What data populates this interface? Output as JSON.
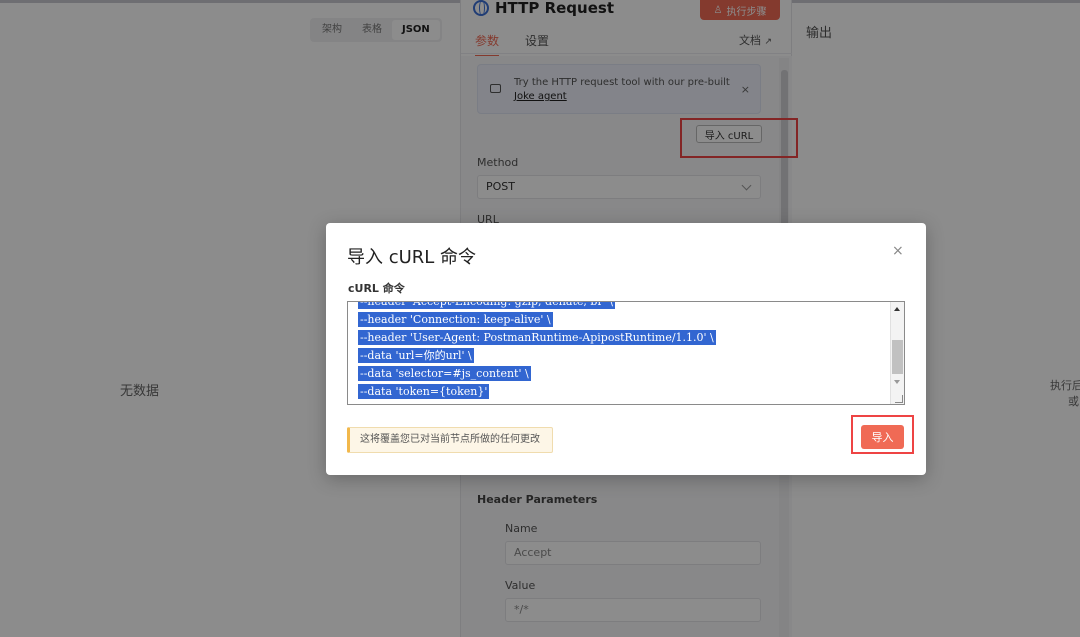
{
  "background": {
    "view_tabs": [
      "架构",
      "表格",
      "JSON"
    ],
    "active_view_tab": "JSON",
    "left_empty_text": "无数据",
    "output_title": "输出",
    "right_hint_line1": "执行后",
    "right_hint_line2": "或"
  },
  "panel": {
    "title": "HTTP Request",
    "run_button_label": "执行步骤",
    "tabs": [
      {
        "label": "参数",
        "active": true
      },
      {
        "label": "设置",
        "active": false
      }
    ],
    "doc_link": "文档",
    "banner": {
      "text": "Try the HTTP request tool with our pre-built",
      "link": "Joke agent",
      "close": "×"
    },
    "import_curl_label": "导入 cURL",
    "method_label": "Method",
    "method_value": "POST",
    "url_label": "URL",
    "header_section_label": "Header Parameters",
    "name_label": "Name",
    "name_value": "Accept",
    "value_label": "Value",
    "value_value": "*/*"
  },
  "modal": {
    "title": "导入 cURL 命令",
    "close": "×",
    "field_label": "cURL 命令",
    "code_lines": [
      "--header 'Accept-Encoding: gzip, deflate, br' \\",
      "--header 'Connection: keep-alive' \\",
      "--header 'User-Agent: PostmanRuntime-ApipostRuntime/1.1.0' \\",
      "--data 'url=你的url' \\",
      "--data 'selector=#js_content' \\",
      "--data 'token={token}'"
    ],
    "warning_text": "这将覆盖您已对当前节点所做的任何更改",
    "import_button_label": "导入"
  },
  "colors": {
    "accent": "#f06a55",
    "selection": "#3266d1",
    "highlight_frame": "#ee4444"
  }
}
